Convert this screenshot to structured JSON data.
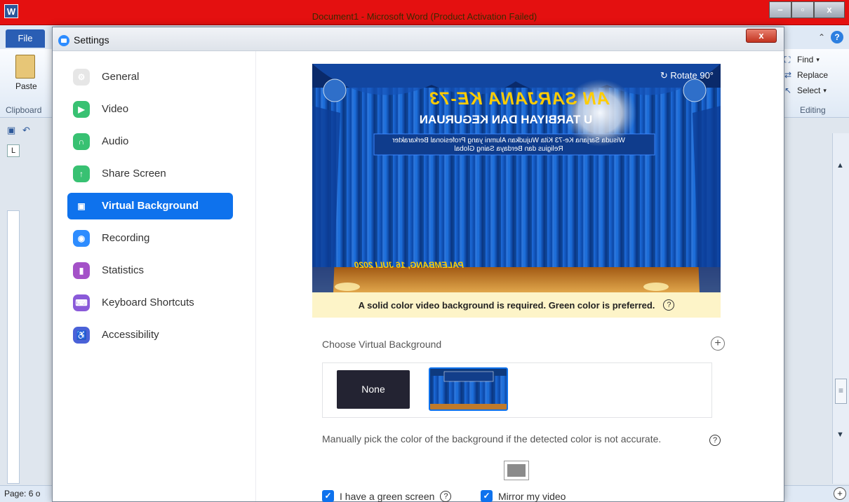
{
  "word": {
    "title": "Document1  -  Microsoft Word (Product Activation Failed)",
    "app_icon": "W",
    "file_tab": "File",
    "paste": "Paste",
    "clipboard": "Clipboard",
    "find": "Find",
    "replace": "Replace",
    "select": "Select",
    "editing": "Editing",
    "status_page": "Page: 6 o"
  },
  "settings": {
    "title": "Settings",
    "close_label": "x",
    "nav": [
      {
        "label": "General",
        "icon": "gear-icon",
        "color": "#e6e6e6"
      },
      {
        "label": "Video",
        "icon": "video-icon",
        "color": "#38c172"
      },
      {
        "label": "Audio",
        "icon": "headphones-icon",
        "color": "#38c172"
      },
      {
        "label": "Share Screen",
        "icon": "share-screen-icon",
        "color": "#38c172"
      },
      {
        "label": "Virtual Background",
        "icon": "virtual-background-icon",
        "color": "#0e72ed",
        "active": true
      },
      {
        "label": "Recording",
        "icon": "record-icon",
        "color": "#2d8cff"
      },
      {
        "label": "Statistics",
        "icon": "statistics-icon",
        "color": "#a451c8"
      },
      {
        "label": "Keyboard Shortcuts",
        "icon": "keyboard-icon",
        "color": "#8a5ad9"
      },
      {
        "label": "Accessibility",
        "icon": "accessibility-icon",
        "color": "#4a62d8"
      }
    ]
  },
  "preview": {
    "rotate_label": "Rotate 90°",
    "heading": "AN SARJANA KE-73",
    "subheading": "U TARBIYAH DAN KEGURUAN",
    "body_text": "Wisuda Sarjana Ke-73 Kita Wujudkan Alumni yang Profesional Berkarakter Religius dan Berdaya Saing Global",
    "date_text": "PALEMBANG, 16 JULI 2020"
  },
  "warning": {
    "text": "A solid color video background is required. Green color is preferred.",
    "help": "?"
  },
  "choose": {
    "label": "Choose Virtual Background",
    "add": "+",
    "none_label": "None"
  },
  "manual": {
    "text": "Manually pick the color of the background if the detected color is not accurate.",
    "help": "?"
  },
  "options": {
    "green_screen": "I have a green screen",
    "green_screen_checked": true,
    "mirror": "Mirror my video",
    "mirror_checked": true,
    "help": "?"
  },
  "colors": {
    "accent": "#0e72ed",
    "word_titlebar": "#e41010",
    "warning_bg": "#fdf4c8"
  }
}
